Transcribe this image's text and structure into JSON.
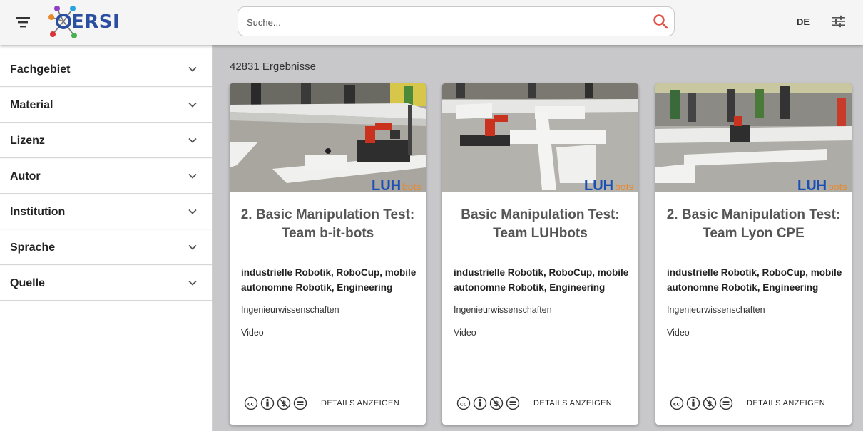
{
  "header": {
    "logo_text": "ERSI",
    "search_placeholder": "Suche...",
    "language": "DE"
  },
  "sidebar": {
    "filters": [
      {
        "label": "Fachgebiet"
      },
      {
        "label": "Material"
      },
      {
        "label": "Lizenz"
      },
      {
        "label": "Autor"
      },
      {
        "label": "Institution"
      },
      {
        "label": "Sprache"
      },
      {
        "label": "Quelle"
      }
    ]
  },
  "main": {
    "results_count": "42831 Ergebnisse",
    "cards": [
      {
        "title": "2. Basic Manipulation Test: Team b-it-bots",
        "keywords": "industrielle Robotik, RoboCup, mobile autonomne Robotik, Engineering",
        "subject": "Ingenieurwissenschaften",
        "type": "Video",
        "brand": "LUH",
        "brand_suffix": "bots",
        "details_label": "DETAILS ANZEIGEN"
      },
      {
        "title": "Basic Manipulation Test: Team LUHbots",
        "keywords": "industrielle Robotik, RoboCup, mobile autonomne Robotik, Engineering",
        "subject": "Ingenieurwissenschaften",
        "type": "Video",
        "brand": "LUH",
        "brand_suffix": "bots",
        "details_label": "DETAILS ANZEIGEN"
      },
      {
        "title": "2. Basic Manipulation Test: Team Lyon CPE",
        "keywords": "industrielle Robotik, RoboCup, mobile autonomne Robotik, Engineering",
        "subject": "Ingenieurwissenschaften",
        "type": "Video",
        "brand": "LUH",
        "brand_suffix": "bots",
        "details_label": "DETAILS ANZEIGEN"
      }
    ]
  },
  "colors": {
    "brand_blue": "#2a4ea0",
    "search_icon": "#e0524a",
    "luh_blue": "#1a4fb5",
    "luh_orange": "#e8892a"
  }
}
